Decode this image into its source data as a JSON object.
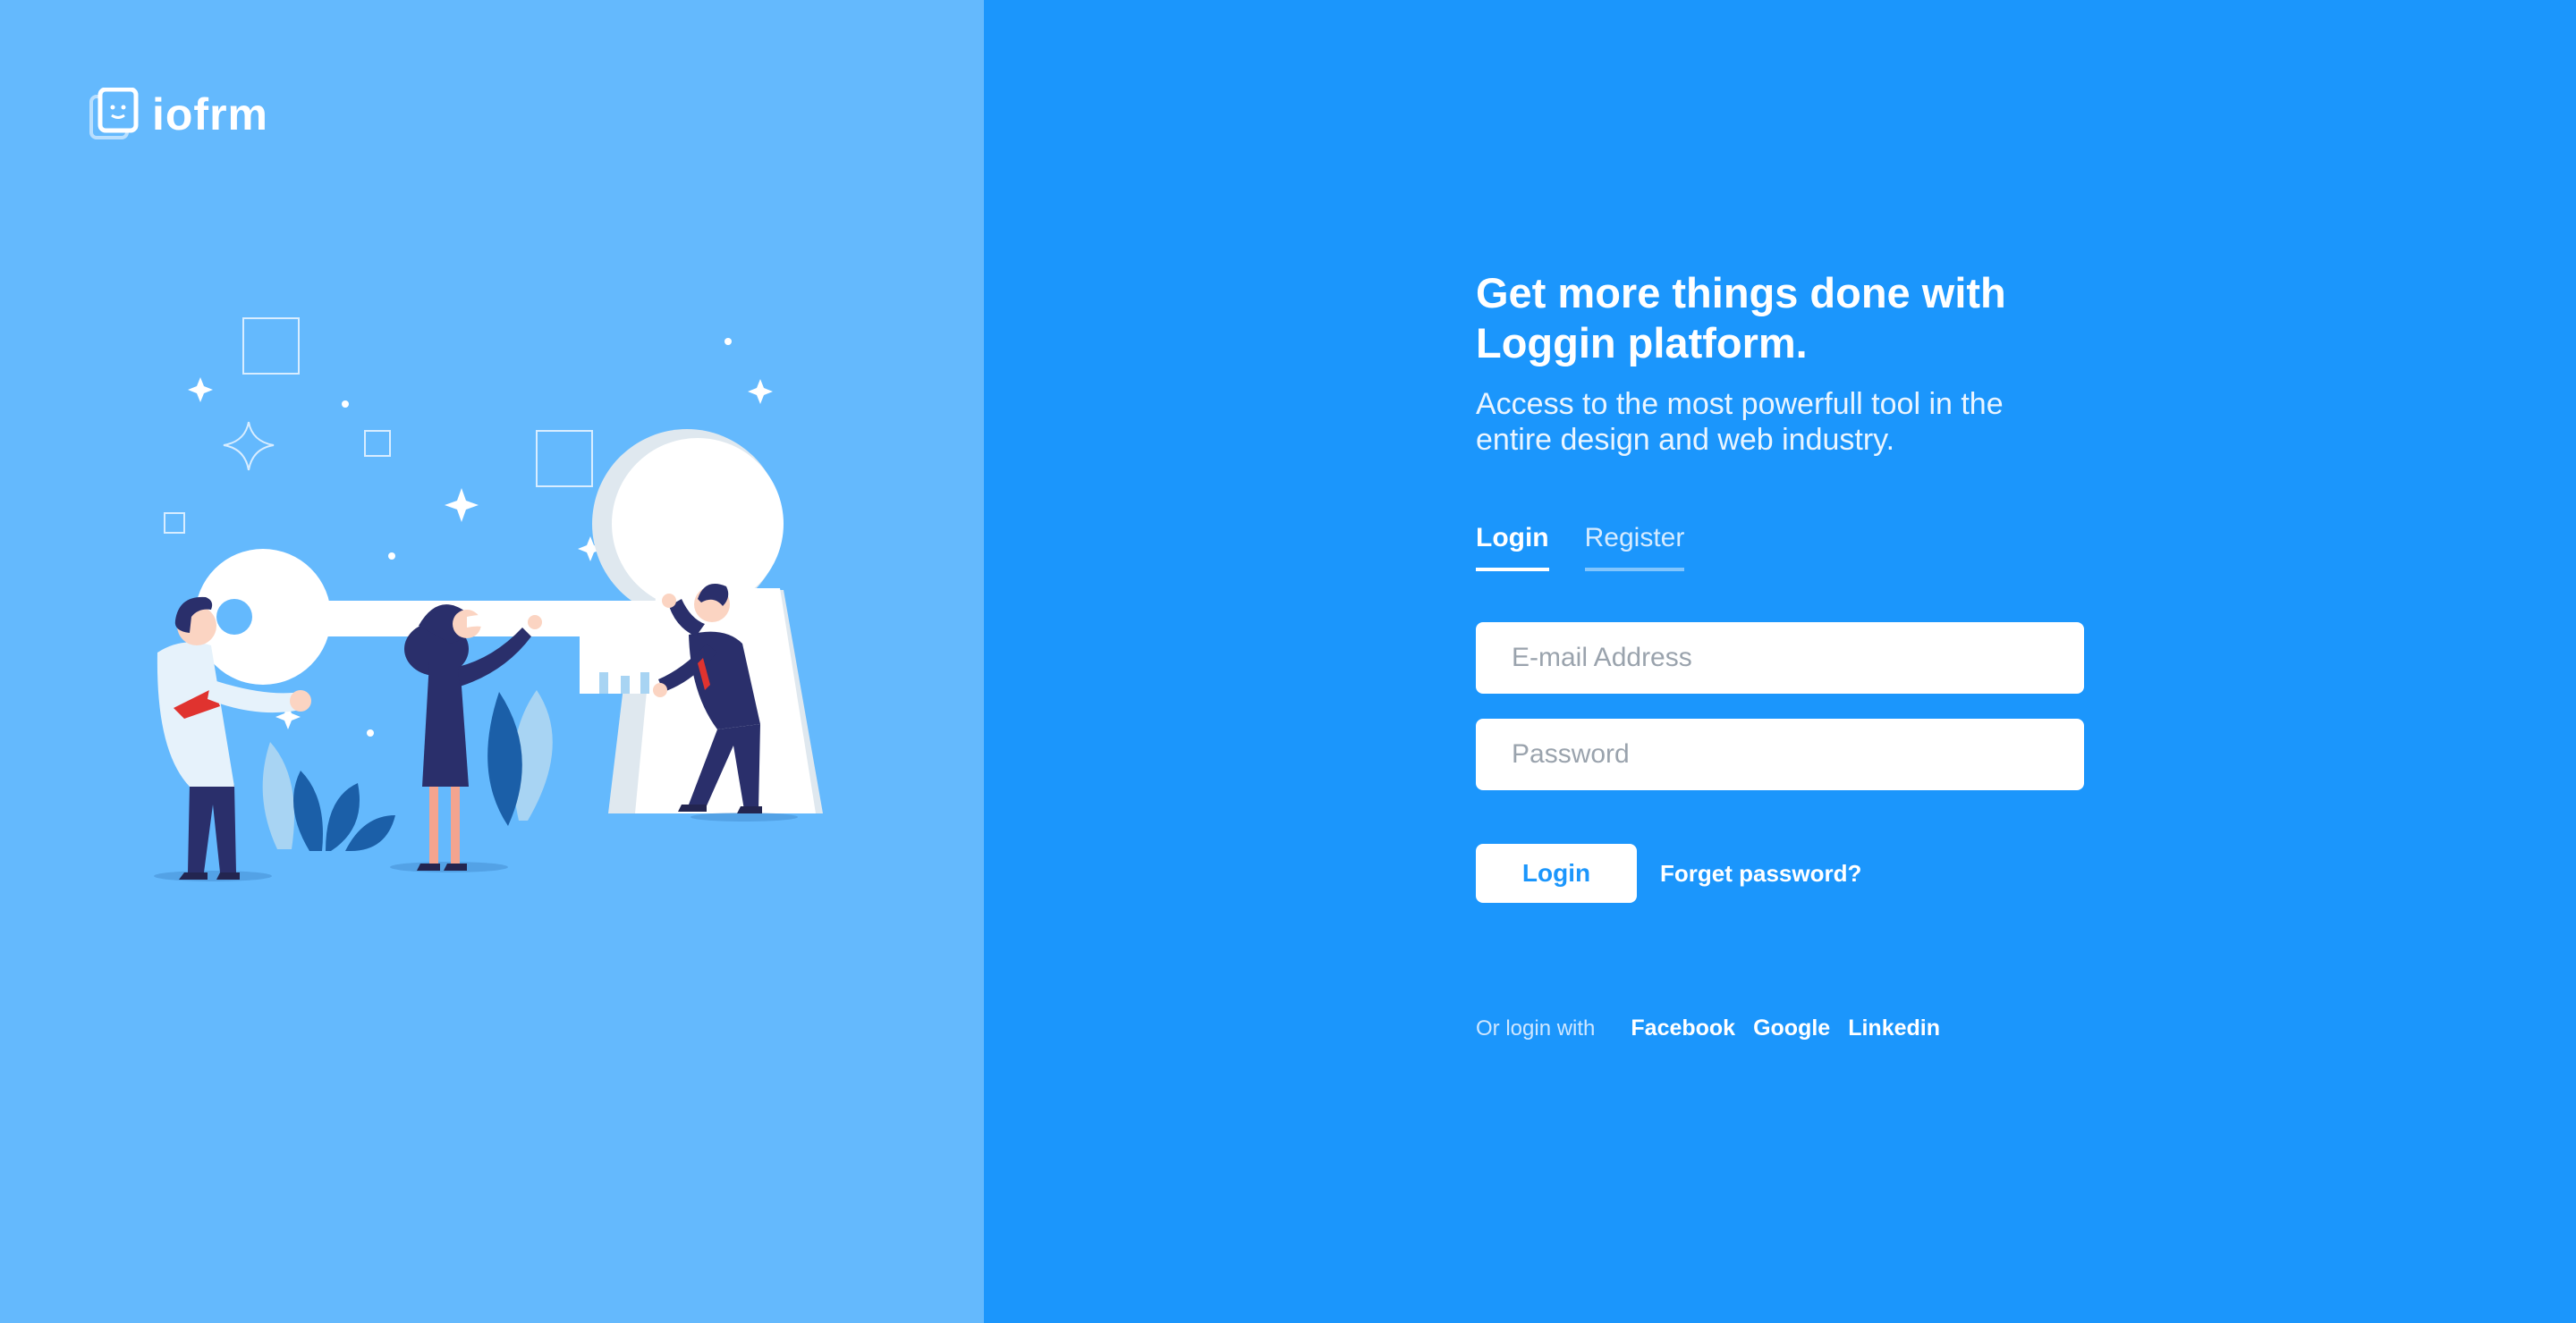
{
  "brand": {
    "name": "iofrm",
    "icon": "logo-icon"
  },
  "headline": "Get more things done with Loggin platform.",
  "subheadline": "Access to the most powerfull tool in the entire design and web industry.",
  "tabs": [
    {
      "label": "Login",
      "active": true
    },
    {
      "label": "Register",
      "active": false
    }
  ],
  "form": {
    "email": {
      "placeholder": "E-mail Address",
      "value": ""
    },
    "password": {
      "placeholder": "Password",
      "value": ""
    },
    "login_label": "Login",
    "forgot_label": "Forget password?"
  },
  "social": {
    "label": "Or login with",
    "links": [
      "Facebook",
      "Google",
      "Linkedin"
    ]
  },
  "colors": {
    "left_panel": "#64b9fd",
    "right_panel": "#1b96fc",
    "white": "#ffffff",
    "navy": "#2a2f6b",
    "accent_red": "#e0332f"
  },
  "illustration": {
    "icon": "key-keyhole-team-illustration"
  }
}
